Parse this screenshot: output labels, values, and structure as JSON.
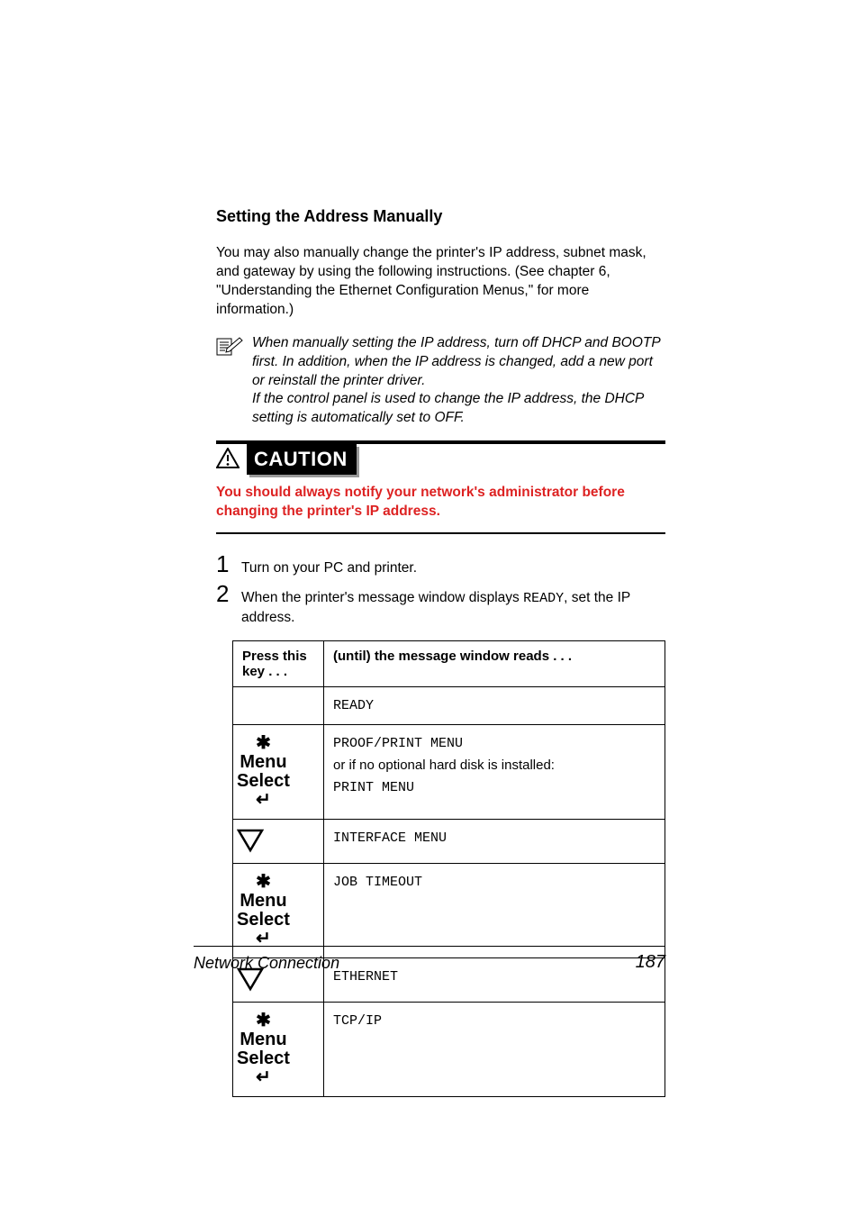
{
  "heading": "Setting the Address Manually",
  "intro_para": "You may also manually change the printer's IP address, subnet mask, and gateway by using the following instructions. (See chapter 6, \"Understanding the Ethernet Configuration Menus,\" for more information.)",
  "note": {
    "line1": "When manually setting the IP address, turn off DHCP and BOOTP first. In addition, when the IP address is changed, add a new port or reinstall the printer driver.",
    "line2": "If the control panel is used to change the IP address, the DHCP setting is automatically set to OFF."
  },
  "caution": {
    "label": "CAUTION",
    "body": "You should always notify your network's administrator before changing the printer's IP address."
  },
  "steps": [
    {
      "num": "1",
      "text_before": "Turn on your PC and printer."
    },
    {
      "num": "2",
      "text_before": "When the printer's message window displays ",
      "mono": "READY",
      "text_after": ", set the IP address."
    }
  ],
  "table": {
    "head_key": "Press this key . . .",
    "head_msg": "(until) the message window reads  . . .",
    "rows": [
      {
        "key_type": "blank",
        "msg_mono": "READY"
      },
      {
        "key_type": "menu_select",
        "msg_mono": "PROOF/PRINT MENU",
        "msg_plain": "or if no optional hard disk is installed:",
        "msg_mono2": "PRINT MENU"
      },
      {
        "key_type": "down",
        "msg_mono": "INTERFACE MENU"
      },
      {
        "key_type": "menu_select",
        "msg_mono": "JOB TIMEOUT"
      },
      {
        "key_type": "down",
        "msg_mono": "ETHERNET"
      },
      {
        "key_type": "menu_select",
        "msg_mono": "TCP/IP"
      }
    ],
    "key_labels": {
      "menu": "Menu",
      "select": "Select"
    }
  },
  "footer": {
    "title": "Network Connection",
    "page": "187"
  }
}
